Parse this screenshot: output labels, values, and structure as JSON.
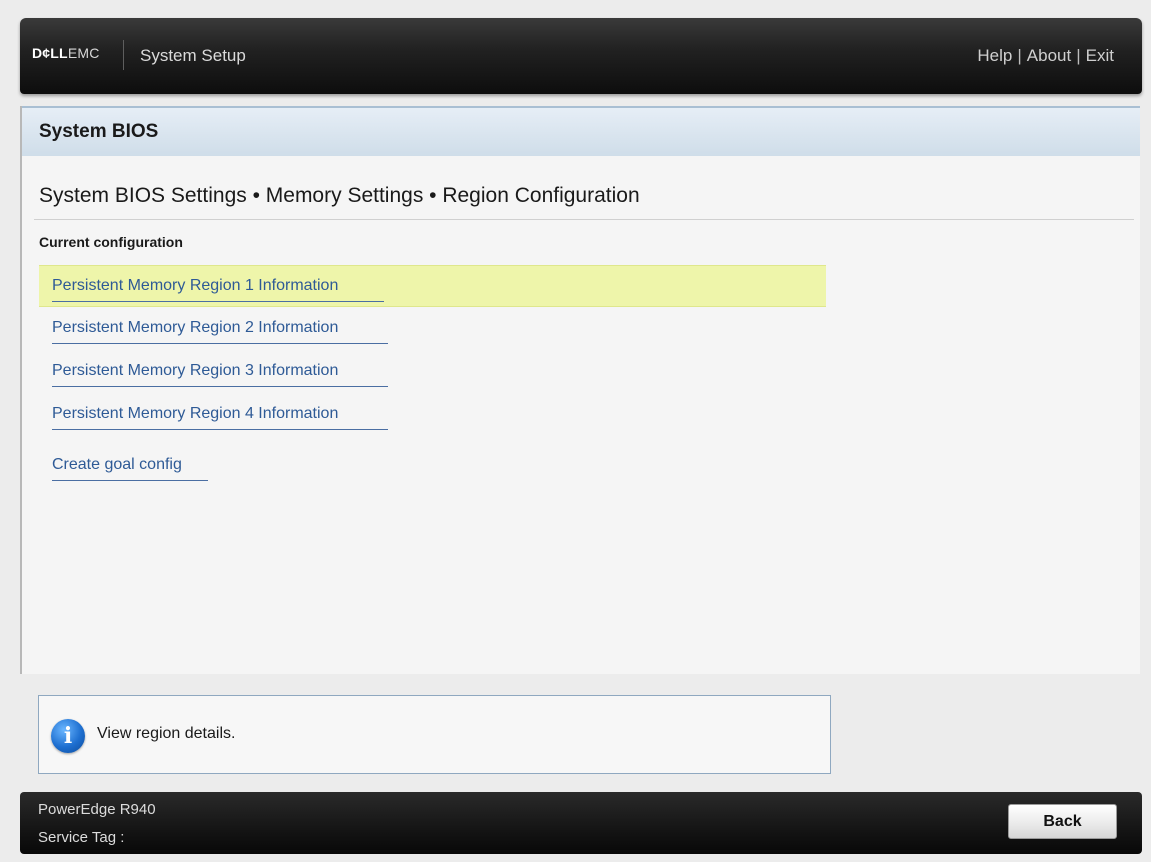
{
  "header": {
    "brand_bold": "D¢LL",
    "brand_light": "EMC",
    "app_title": "System Setup",
    "nav": {
      "help": "Help",
      "about": "About",
      "exit": "Exit",
      "separator": "|"
    }
  },
  "section": {
    "title": "System BIOS",
    "breadcrumb": "System BIOS Settings • Memory Settings • Region Configuration",
    "group_label": "Current configuration"
  },
  "menu": {
    "items": [
      {
        "label": "Persistent Memory Region 1 Information",
        "selected": true
      },
      {
        "label": "Persistent Memory Region 2 Information",
        "selected": false
      },
      {
        "label": "Persistent Memory Region 3 Information",
        "selected": false
      },
      {
        "label": "Persistent Memory Region 4 Information",
        "selected": false
      },
      {
        "label": "Create goal config",
        "selected": false
      }
    ]
  },
  "help": {
    "icon": "info-icon",
    "icon_glyph": "i",
    "text": "View region details."
  },
  "footer": {
    "model": "PowerEdge R940",
    "service_tag_label": "Service Tag :",
    "back_label": "Back"
  },
  "colors": {
    "selected_row": "#eef5aa",
    "link": "#2e5a96",
    "header_bar": "#1c1c1c"
  }
}
